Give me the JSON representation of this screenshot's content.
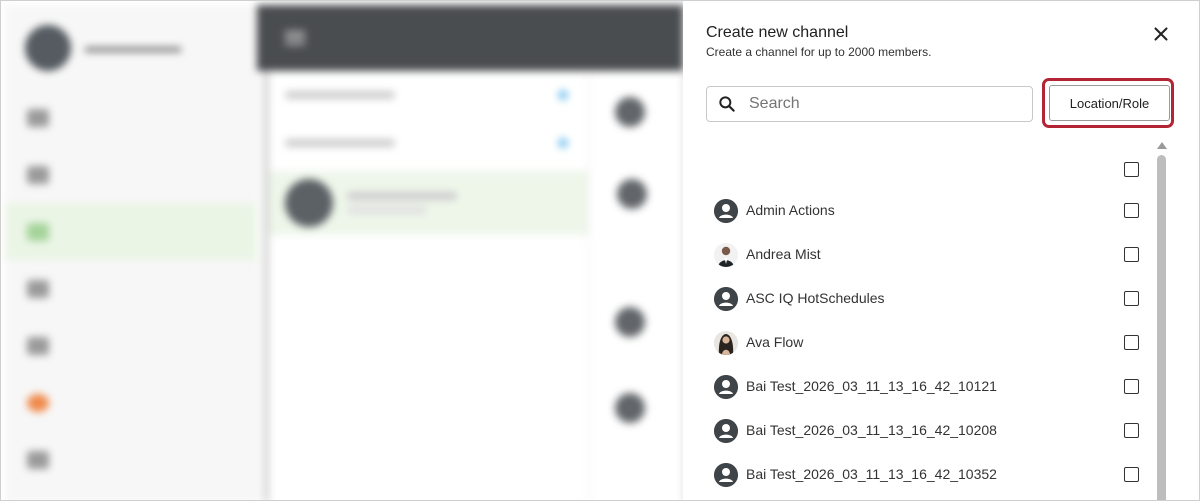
{
  "panel": {
    "title": "Create new channel",
    "subtitle": "Create a channel for up to 2000 members.",
    "search_placeholder": "Search",
    "location_role_label": "Location/Role"
  },
  "members": [
    {
      "name": "Admin Actions",
      "avatar": "person-icon"
    },
    {
      "name": "Andrea Mist",
      "avatar": "photo-man"
    },
    {
      "name": "ASC IQ HotSchedules",
      "avatar": "person-icon"
    },
    {
      "name": "Ava Flow",
      "avatar": "photo-woman"
    },
    {
      "name": "Bai Test_2026_03_11_13_16_42_10121",
      "avatar": "person-icon"
    },
    {
      "name": "Bai Test_2026_03_11_13_16_42_10208",
      "avatar": "person-icon"
    },
    {
      "name": "Bai Test_2026_03_11_13_16_42_10352",
      "avatar": "person-icon"
    }
  ],
  "colors": {
    "highlight": "#b32434",
    "avatar_bg": "#3f4448",
    "topbar": "#4a4d50"
  }
}
